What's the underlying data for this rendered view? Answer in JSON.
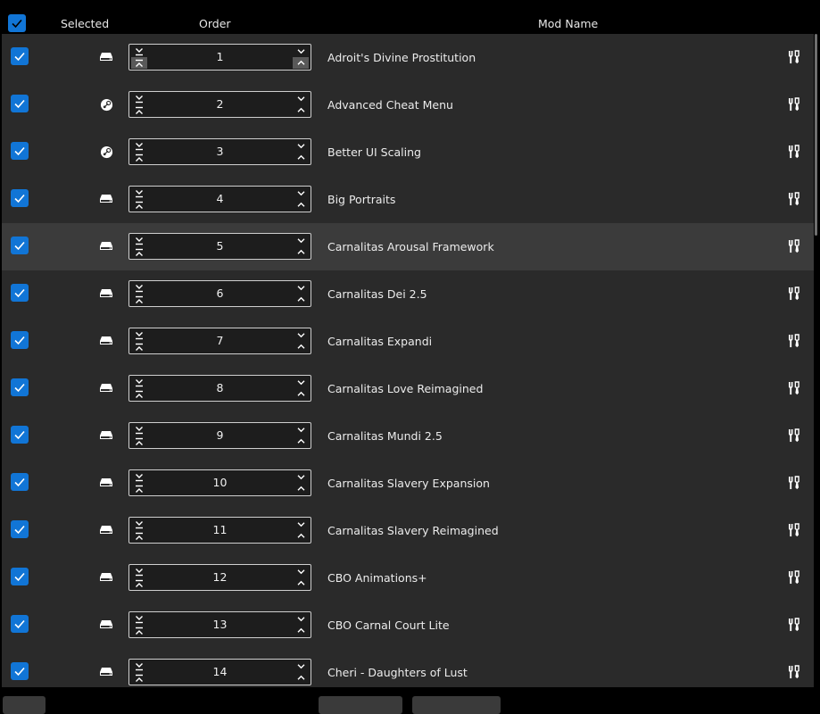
{
  "header": {
    "select_all_checked": true,
    "columns": {
      "selected": "Selected",
      "order": "Order",
      "mod_name": "Mod Name"
    }
  },
  "icons": {
    "local": "drive-icon",
    "steam": "steam-icon",
    "move_to_bottom": "move-to-bottom-icon",
    "move_to_top": "move-to-top-icon",
    "move_down": "chevron-down-icon",
    "move_up": "chevron-up-icon",
    "action": "tools-icon"
  },
  "colors": {
    "accent": "#1175d6",
    "row_bg": "#2a2a2a",
    "row_highlight": "#3b3b3b",
    "header_bg": "#000000"
  },
  "rows": [
    {
      "selected": true,
      "source": "local",
      "order": "1",
      "name": "Adroit's Divine Prostitution",
      "first": true,
      "highlight": false
    },
    {
      "selected": true,
      "source": "steam",
      "order": "2",
      "name": "Advanced Cheat Menu",
      "first": false,
      "highlight": false
    },
    {
      "selected": true,
      "source": "steam",
      "order": "3",
      "name": "Better UI Scaling",
      "first": false,
      "highlight": false
    },
    {
      "selected": true,
      "source": "local",
      "order": "4",
      "name": "Big Portraits",
      "first": false,
      "highlight": false
    },
    {
      "selected": true,
      "source": "local",
      "order": "5",
      "name": "Carnalitas Arousal Framework",
      "first": false,
      "highlight": true
    },
    {
      "selected": true,
      "source": "local",
      "order": "6",
      "name": "Carnalitas Dei 2.5",
      "first": false,
      "highlight": false
    },
    {
      "selected": true,
      "source": "local",
      "order": "7",
      "name": "Carnalitas Expandi",
      "first": false,
      "highlight": false
    },
    {
      "selected": true,
      "source": "local",
      "order": "8",
      "name": "Carnalitas Love Reimagined",
      "first": false,
      "highlight": false
    },
    {
      "selected": true,
      "source": "local",
      "order": "9",
      "name": "Carnalitas Mundi 2.5",
      "first": false,
      "highlight": false
    },
    {
      "selected": true,
      "source": "local",
      "order": "10",
      "name": "Carnalitas Slavery Expansion",
      "first": false,
      "highlight": false
    },
    {
      "selected": true,
      "source": "local",
      "order": "11",
      "name": "Carnalitas Slavery Reimagined",
      "first": false,
      "highlight": false
    },
    {
      "selected": true,
      "source": "local",
      "order": "12",
      "name": "CBO Animations+",
      "first": false,
      "highlight": false
    },
    {
      "selected": true,
      "source": "local",
      "order": "13",
      "name": "CBO Carnal Court Lite",
      "first": false,
      "highlight": false
    },
    {
      "selected": true,
      "source": "local",
      "order": "14",
      "name": "Cheri - Daughters of Lust",
      "first": false,
      "highlight": false
    }
  ]
}
